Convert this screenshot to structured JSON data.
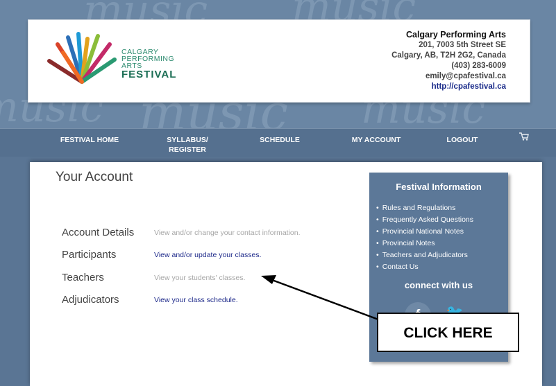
{
  "header": {
    "decor_word": "music",
    "logo": {
      "line1": "CALGARY",
      "line2": "PERFORMING",
      "line3": "ARTS",
      "line4": "FESTIVAL"
    },
    "contact": {
      "org": "Calgary Performing Arts",
      "street": "201, 7003 5th Street SE",
      "city": "Calgary, AB, T2H 2G2, Canada",
      "phone": "(403) 283-6009",
      "email": "emily@cpafestival.ca",
      "website": "http://cpafestival.ca"
    }
  },
  "nav": {
    "items": [
      {
        "label": "FESTIVAL HOME"
      },
      {
        "label": "SYLLABUS/\nREGISTER"
      },
      {
        "label": "SCHEDULE"
      },
      {
        "label": "MY ACCOUNT"
      },
      {
        "label": "LOGOUT"
      }
    ],
    "cart_icon": "cart-icon"
  },
  "main": {
    "title": "Your Account",
    "rows": [
      {
        "label": "Account Details",
        "link": "View and/or change your contact information."
      },
      {
        "label": "Participants",
        "link": "View and/or update your classes."
      },
      {
        "label": "Teachers",
        "link": "View your students' classes."
      },
      {
        "label": "Adjudicators",
        "link": "View your class schedule."
      }
    ]
  },
  "sidebar": {
    "title": "Festival Information",
    "items": [
      "Rules and Regulations",
      "Frequently Asked Questions",
      "Provincial National Notes",
      "Provincial Notes",
      "Teachers and Adjudicators",
      "Contact Us"
    ],
    "connect": "connect with us",
    "social": {
      "facebook": "f",
      "twitter": "🐦"
    }
  },
  "annotation": {
    "callout": "CLICK HERE"
  },
  "colors": {
    "page_bg": "#5a7594",
    "nav_bg": "#55708f",
    "link": "#1e2a8a",
    "muted_link": "#a6a6a6",
    "logo_green": "#2b8a6e"
  }
}
